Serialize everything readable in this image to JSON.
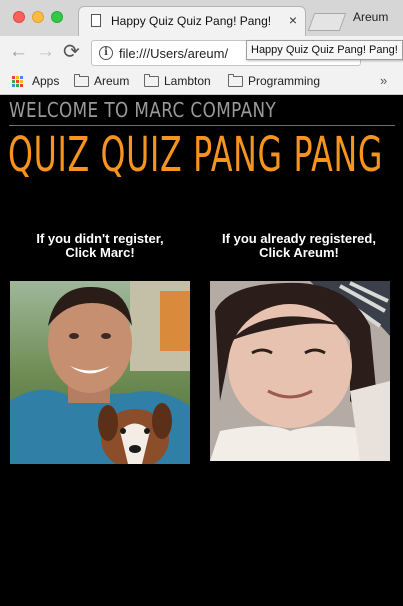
{
  "browser": {
    "tab_title": "Happy Quiz Quiz Pang! Pang!",
    "tab_close": "×",
    "profile_name": "Areum",
    "url": "file:///Users/areum/",
    "tooltip": "Happy Quiz Quiz Pang! Pang!",
    "nav": {
      "back": "←",
      "forward": "→",
      "reload": "⟳",
      "info": "i"
    },
    "bookmarks": {
      "apps": "Apps",
      "items": [
        "Areum",
        "Lambton",
        "Programming"
      ],
      "more": "»"
    }
  },
  "page": {
    "welcome": "WELCOME TO MARC COMPANY",
    "headline": "QUIZ QUIZ PANG PANG",
    "left_caption": "If you didn't register, Click Marc!",
    "right_caption": "If you already registered, Click Areum!",
    "colors": {
      "headline": "#f7941d",
      "welcome": "#9a9a9a",
      "background": "#000000"
    }
  },
  "icons": [
    "document-icon",
    "close-icon",
    "back-arrow-icon",
    "forward-arrow-icon",
    "reload-icon",
    "info-icon",
    "apps-grid-icon",
    "folder-icon",
    "chevron-more-icon"
  ]
}
